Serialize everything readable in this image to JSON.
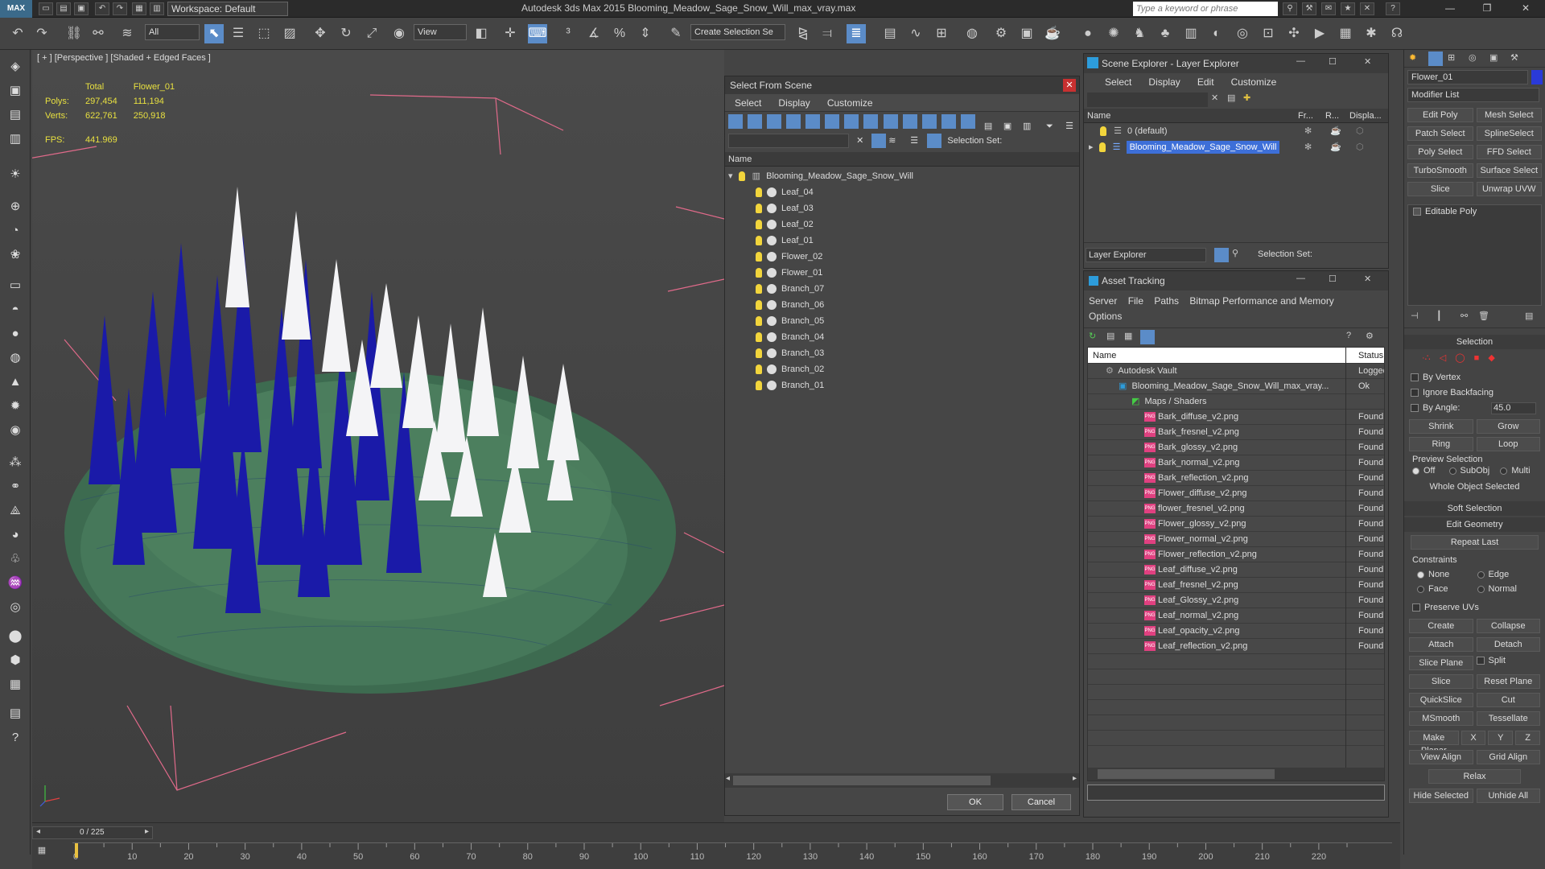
{
  "titlebar": {
    "logo": "MAX",
    "workspace": "Workspace: Default",
    "app_title": "Autodesk 3ds Max  2015      Blooming_Meadow_Sage_Snow_Will_max_vray.max",
    "search_placeholder": "Type a keyword or phrase"
  },
  "toolbar": {
    "selection_filter": "All",
    "ref_coord": "View",
    "named_selection": "Create Selection Se"
  },
  "viewport": {
    "label": "[ + ] [Perspective ] [Shaded + Edged Faces ]",
    "stats": {
      "total_label": "Total",
      "object_label": "Flower_01",
      "polys_label": "Polys:",
      "polys_total": "297,454",
      "polys_object": "111,194",
      "verts_label": "Verts:",
      "verts_total": "622,761",
      "verts_object": "250,918",
      "fps_label": "FPS:",
      "fps_value": "441.969"
    }
  },
  "select_from_scene": {
    "title": "Select From Scene",
    "menu": [
      "Select",
      "Display",
      "Customize"
    ],
    "selection_set_label": "Selection Set:",
    "column_name": "Name",
    "root": "Blooming_Meadow_Sage_Snow_Will",
    "items": [
      "Leaf_04",
      "Leaf_03",
      "Leaf_02",
      "Leaf_01",
      "Flower_02",
      "Flower_01",
      "Branch_07",
      "Branch_06",
      "Branch_05",
      "Branch_04",
      "Branch_03",
      "Branch_02",
      "Branch_01"
    ],
    "ok": "OK",
    "cancel": "Cancel"
  },
  "scene_explorer": {
    "title": "Scene Explorer - Layer Explorer",
    "menu": [
      "Select",
      "Display",
      "Edit",
      "Customize"
    ],
    "columns": [
      "Name",
      "Fr...",
      "R...",
      "Displa..."
    ],
    "layers": [
      "0 (default)",
      "Blooming_Meadow_Sage_Snow_Will"
    ],
    "footer_dropdown": "Layer Explorer",
    "selection_set_label": "Selection Set:"
  },
  "asset_tracking": {
    "title": "Asset Tracking",
    "menu": [
      "Server",
      "File",
      "Paths",
      "Bitmap Performance and Memory",
      "Options"
    ],
    "columns": [
      "Name",
      "Status"
    ],
    "vault": {
      "name": "Autodesk Vault",
      "status": "Logged"
    },
    "file": {
      "name": "Blooming_Meadow_Sage_Snow_Will_max_vray...",
      "status": "Ok"
    },
    "group": "Maps / Shaders",
    "maps": [
      {
        "name": "Bark_diffuse_v2.png",
        "status": "Found"
      },
      {
        "name": "Bark_fresnel_v2.png",
        "status": "Found"
      },
      {
        "name": "Bark_glossy_v2.png",
        "status": "Found"
      },
      {
        "name": "Bark_normal_v2.png",
        "status": "Found"
      },
      {
        "name": "Bark_reflection_v2.png",
        "status": "Found"
      },
      {
        "name": "Flower_diffuse_v2.png",
        "status": "Found"
      },
      {
        "name": "flower_fresnel_v2.png",
        "status": "Found"
      },
      {
        "name": "Flower_glossy_v2.png",
        "status": "Found"
      },
      {
        "name": "Flower_normal_v2.png",
        "status": "Found"
      },
      {
        "name": "Flower_reflection_v2.png",
        "status": "Found"
      },
      {
        "name": "Leaf_diffuse_v2.png",
        "status": "Found"
      },
      {
        "name": "Leaf_fresnel_v2.png",
        "status": "Found"
      },
      {
        "name": "Leaf_Glossy_v2.png",
        "status": "Found"
      },
      {
        "name": "Leaf_normal_v2.png",
        "status": "Found"
      },
      {
        "name": "Leaf_opacity_v2.png",
        "status": "Found"
      },
      {
        "name": "Leaf_reflection_v2.png",
        "status": "Found"
      }
    ]
  },
  "command_panel": {
    "object_name": "Flower_01",
    "modifier_list": "Modifier List",
    "modifier_buttons": [
      "Edit Poly",
      "Mesh Select",
      "Patch Select",
      "SplineSelect",
      "Poly Select",
      "FFD Select",
      "TurboSmooth",
      "Surface Select",
      "Slice",
      "Unwrap UVW"
    ],
    "stack_item": "Editable Poly",
    "selection_rollout": "Selection",
    "by_vertex": "By Vertex",
    "ignore_backfacing": "Ignore Backfacing",
    "by_angle": "By Angle:",
    "by_angle_value": "45.0",
    "shrink": "Shrink",
    "grow": "Grow",
    "ring": "Ring",
    "loop": "Loop",
    "preview_selection": "Preview Selection",
    "preview_off": "Off",
    "preview_subobj": "SubObj",
    "preview_multi": "Multi",
    "whole_object": "Whole Object Selected",
    "soft_selection": "Soft Selection",
    "edit_geometry": "Edit Geometry",
    "repeat_last": "Repeat Last",
    "constraints": "Constraints",
    "c_none": "None",
    "c_edge": "Edge",
    "c_face": "Face",
    "c_normal": "Normal",
    "preserve_uvs": "Preserve UVs",
    "create": "Create",
    "collapse": "Collapse",
    "attach": "Attach",
    "detach": "Detach",
    "slice_plane": "Slice Plane",
    "split": "Split",
    "slice": "Slice",
    "reset_plane": "Reset Plane",
    "quickslice": "QuickSlice",
    "cut": "Cut",
    "msmooth": "MSmooth",
    "tessellate": "Tessellate",
    "make_planar": "Make Planar",
    "x": "X",
    "y": "Y",
    "z": "Z",
    "view_align": "View Align",
    "grid_align": "Grid Align",
    "relax": "Relax",
    "hide_selected": "Hide Selected",
    "unhide_all": "Unhide All"
  },
  "timeline": {
    "frame": "0 / 225",
    "ticks": [
      "0",
      "10",
      "20",
      "30",
      "40",
      "50",
      "60",
      "70",
      "80",
      "90",
      "100",
      "110",
      "120",
      "130",
      "140",
      "150",
      "160",
      "170",
      "180",
      "190",
      "200",
      "210",
      "220"
    ]
  },
  "colors": {
    "accent": "#5b8cc8",
    "stats_yellow": "#e8e040",
    "selected_row": "#3d6fd8",
    "close_red": "#c83030"
  }
}
